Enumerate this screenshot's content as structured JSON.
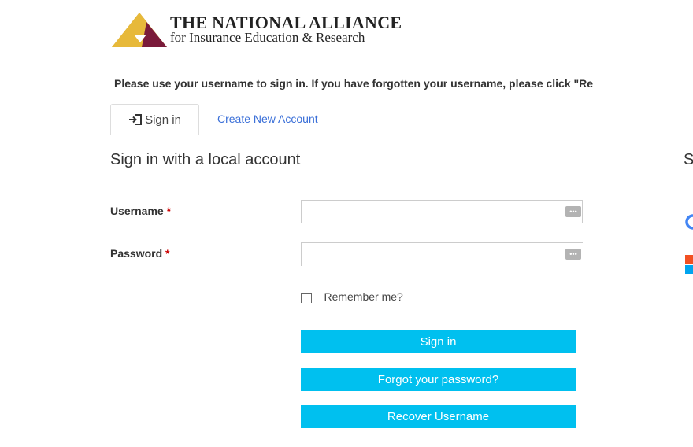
{
  "logo": {
    "line1": "THE NATIONAL ALLIANCE",
    "line2": "for Insurance Education & Research"
  },
  "notice": "Please use your username to sign in. If you have forgotten your username, please click \"Re",
  "tabs": {
    "signin": "Sign in",
    "create": "Create New Account"
  },
  "form": {
    "heading": "Sign in with a local account",
    "username_label": "Username",
    "password_label": "Password",
    "required_mark": "*",
    "username_value": "",
    "password_value": "",
    "remember_label": "Remember me?",
    "remember_checked": false
  },
  "buttons": {
    "signin": "Sign in",
    "forgot": "Forgot your password?",
    "recover": "Recover Username"
  },
  "external": {
    "heading_fragment": "S"
  },
  "colors": {
    "button": "#00c0ef",
    "link": "#3a6fd8",
    "required": "#cc0000",
    "logo_gold": "#d4a52a",
    "logo_maroon": "#7a1a3a"
  }
}
